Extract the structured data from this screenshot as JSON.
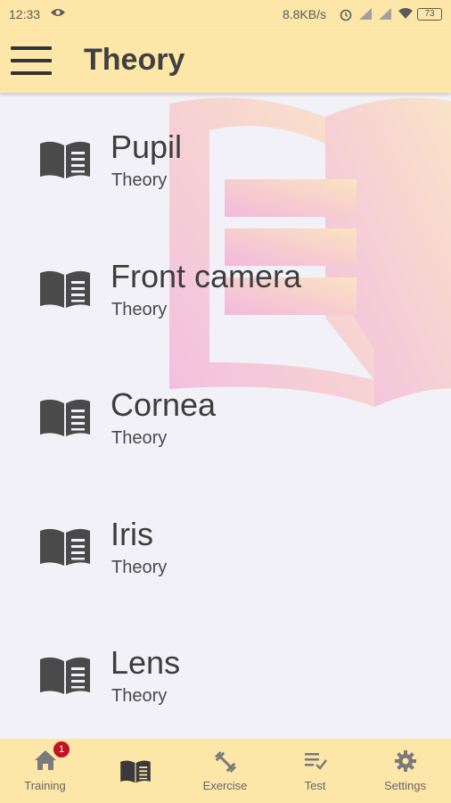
{
  "status_bar": {
    "time": "12:33",
    "speed": "8.8KB/s",
    "battery": "73"
  },
  "toolbar": {
    "title": "Theory"
  },
  "items": [
    {
      "title": "Pupil",
      "subtitle": "Theory"
    },
    {
      "title": "Front camera",
      "subtitle": "Theory"
    },
    {
      "title": "Cornea",
      "subtitle": "Theory"
    },
    {
      "title": "Iris",
      "subtitle": "Theory"
    },
    {
      "title": "Lens",
      "subtitle": "Theory"
    }
  ],
  "bottom_nav": {
    "training": {
      "label": "Training",
      "badge": "1",
      "icon": "home-icon"
    },
    "theory": {
      "icon": "book-icon",
      "selected": true
    },
    "exercise": {
      "label": "Exercise",
      "icon": "dumbbell-icon"
    },
    "test": {
      "label": "Test",
      "icon": "checklist-icon"
    },
    "settings": {
      "label": "Settings",
      "icon": "gear-icon"
    }
  },
  "colors": {
    "bar_background": "#fde7a8",
    "content_background": "#f2f1f7",
    "icon_dark": "#4a4a4a",
    "badge": "#c11226"
  }
}
